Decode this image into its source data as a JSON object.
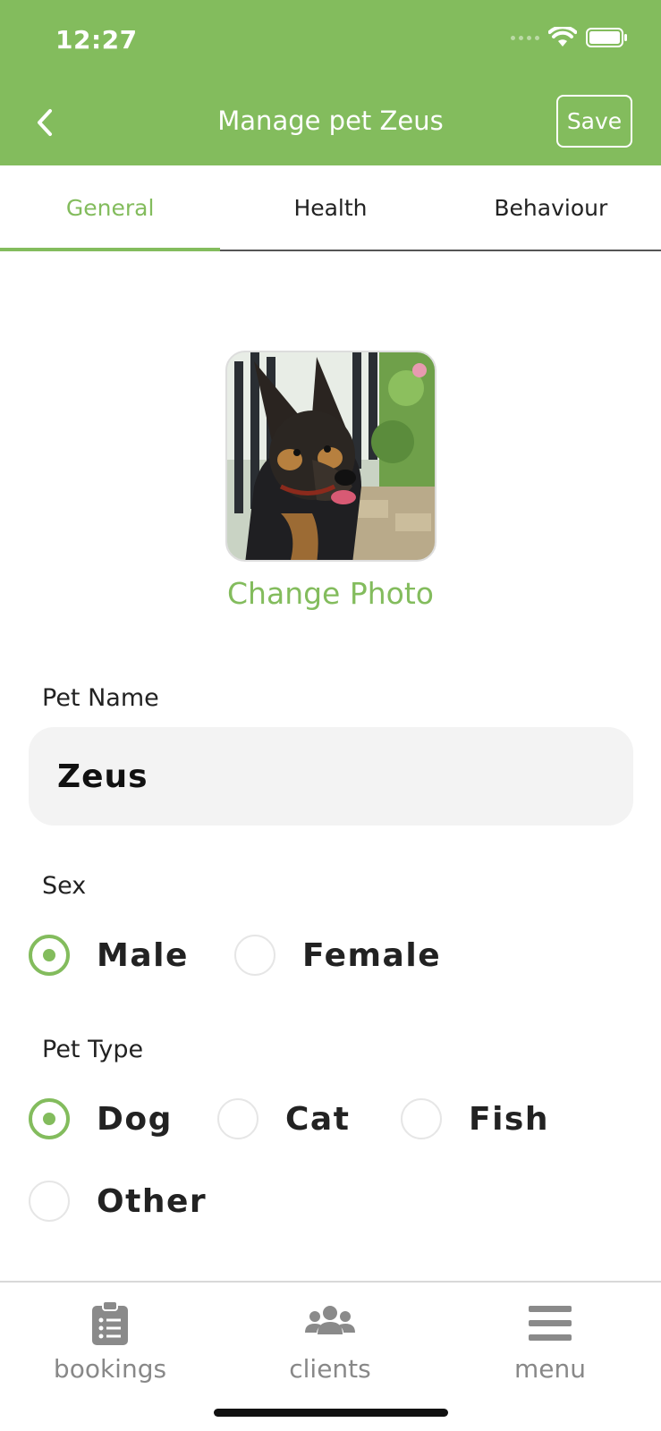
{
  "status_bar": {
    "time": "12:27"
  },
  "header": {
    "title": "Manage pet Zeus",
    "save_label": "Save"
  },
  "tabs": [
    {
      "label": "General",
      "active": true
    },
    {
      "label": "Health",
      "active": false
    },
    {
      "label": "Behaviour",
      "active": false
    }
  ],
  "photo": {
    "change_label": "Change Photo"
  },
  "form": {
    "pet_name": {
      "label": "Pet Name",
      "value": "Zeus"
    },
    "sex": {
      "label": "Sex",
      "options": [
        {
          "label": "Male",
          "selected": true
        },
        {
          "label": "Female",
          "selected": false
        }
      ]
    },
    "pet_type": {
      "label": "Pet Type",
      "options": [
        {
          "label": "Dog",
          "selected": true
        },
        {
          "label": "Cat",
          "selected": false
        },
        {
          "label": "Fish",
          "selected": false
        },
        {
          "label": "Other",
          "selected": false
        }
      ]
    }
  },
  "bottom_nav": [
    {
      "label": "bookings",
      "icon": "clipboard-list-icon"
    },
    {
      "label": "clients",
      "icon": "users-icon"
    },
    {
      "label": "menu",
      "icon": "hamburger-menu-icon"
    }
  ],
  "colors": {
    "accent": "#83bc5d",
    "nav_gray": "#888888",
    "input_bg": "#f3f3f3"
  }
}
